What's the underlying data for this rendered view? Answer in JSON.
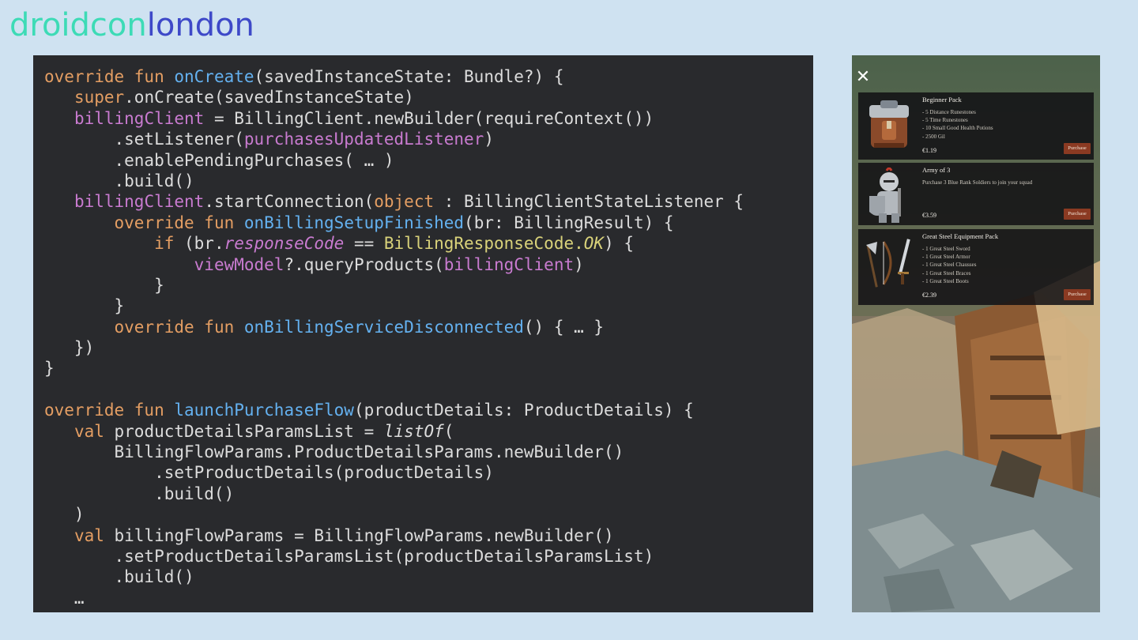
{
  "logo": {
    "part1": "droidcon",
    "part2": "london"
  },
  "code_lines": [
    [
      [
        "kw",
        "override fun "
      ],
      [
        "fn",
        "onCreate"
      ],
      [
        "p",
        "(savedInstanceState: Bundle?) {"
      ]
    ],
    [
      [
        "p",
        "   "
      ],
      [
        "kw",
        "super"
      ],
      [
        "p",
        ".onCreate(savedInstanceState)"
      ]
    ],
    [
      [
        "p",
        "   "
      ],
      [
        "prop",
        "billingClient"
      ],
      [
        "p",
        " = BillingClient.newBuilder(requireContext())"
      ]
    ],
    [
      [
        "p",
        "       .setListener("
      ],
      [
        "prop",
        "purchasesUpdatedListener"
      ],
      [
        "p",
        ")"
      ]
    ],
    [
      [
        "p",
        "       .enablePendingPurchases( … )"
      ]
    ],
    [
      [
        "p",
        "       .build()"
      ]
    ],
    [
      [
        "p",
        "   "
      ],
      [
        "prop",
        "billingClient"
      ],
      [
        "p",
        ".startConnection("
      ],
      [
        "kw",
        "object"
      ],
      [
        "p",
        " : BillingClientStateListener {"
      ]
    ],
    [
      [
        "p",
        "       "
      ],
      [
        "kw",
        "override fun "
      ],
      [
        "fn",
        "onBillingSetupFinished"
      ],
      [
        "p",
        "(br: BillingResult) {"
      ]
    ],
    [
      [
        "p",
        "           "
      ],
      [
        "kw",
        "if"
      ],
      [
        "p",
        " (br."
      ],
      [
        "itp",
        "responseCode"
      ],
      [
        "p",
        " == "
      ],
      [
        "cls",
        "BillingResponseCode."
      ],
      [
        "ity",
        "OK"
      ],
      [
        "p",
        ") {"
      ]
    ],
    [
      [
        "p",
        "               "
      ],
      [
        "prop",
        "viewModel"
      ],
      [
        "p",
        "?.queryProducts("
      ],
      [
        "prop",
        "billingClient"
      ],
      [
        "p",
        ")"
      ]
    ],
    [
      [
        "p",
        "           }"
      ]
    ],
    [
      [
        "p",
        "       }"
      ]
    ],
    [
      [
        "p",
        "       "
      ],
      [
        "kw",
        "override fun "
      ],
      [
        "fn",
        "onBillingServiceDisconnected"
      ],
      [
        "p",
        "() { … }"
      ]
    ],
    [
      [
        "p",
        "   })"
      ]
    ],
    [
      [
        "p",
        "}"
      ]
    ],
    [
      [
        "p",
        ""
      ]
    ],
    [
      [
        "kw",
        "override fun "
      ],
      [
        "fn",
        "launchPurchaseFlow"
      ],
      [
        "p",
        "(productDetails: ProductDetails) {"
      ]
    ],
    [
      [
        "p",
        "   "
      ],
      [
        "kw",
        "val"
      ],
      [
        "p",
        " productDetailsParamsList = "
      ],
      [
        "it",
        "listOf"
      ],
      [
        "p",
        "("
      ]
    ],
    [
      [
        "p",
        "       BillingFlowParams.ProductDetailsParams.newBuilder()"
      ]
    ],
    [
      [
        "p",
        "           .setProductDetails(productDetails)"
      ]
    ],
    [
      [
        "p",
        "           .build()"
      ]
    ],
    [
      [
        "p",
        "   )"
      ]
    ],
    [
      [
        "p",
        "   "
      ],
      [
        "kw",
        "val"
      ],
      [
        "p",
        " billingFlowParams = BillingFlowParams.newBuilder()"
      ]
    ],
    [
      [
        "p",
        "       .setProductDetailsParamsList(productDetailsParamsList)"
      ]
    ],
    [
      [
        "p",
        "       .build()"
      ]
    ],
    [
      [
        "p",
        "   …"
      ]
    ]
  ],
  "store": {
    "close_icon": "close-icon",
    "products": [
      {
        "title": "Beginner Pack",
        "items": [
          "- 5 Distance Runestones",
          "- 5 Time Runestones",
          "- 10 Small Good Health Potions",
          "- 2500 Gil"
        ],
        "price": "€1.19",
        "button": "Purchase",
        "icon": "backpack-icon"
      },
      {
        "title": "Army of 3",
        "items": [
          "Purchase 3 Blue Rank Soldiers to join your squad"
        ],
        "price": "€3.59",
        "button": "Purchase",
        "icon": "knight-icon"
      },
      {
        "title": "Great Steel Equipment Pack",
        "items": [
          "- 1 Great Steel Sword",
          "- 1 Great Steel Armor",
          "- 1 Great Steel Chausses",
          "- 1 Great Steel Braces",
          "- 1 Great Steel Boots"
        ],
        "price": "€2.39",
        "button": "Purchase",
        "icon": "weapons-icon"
      }
    ]
  }
}
